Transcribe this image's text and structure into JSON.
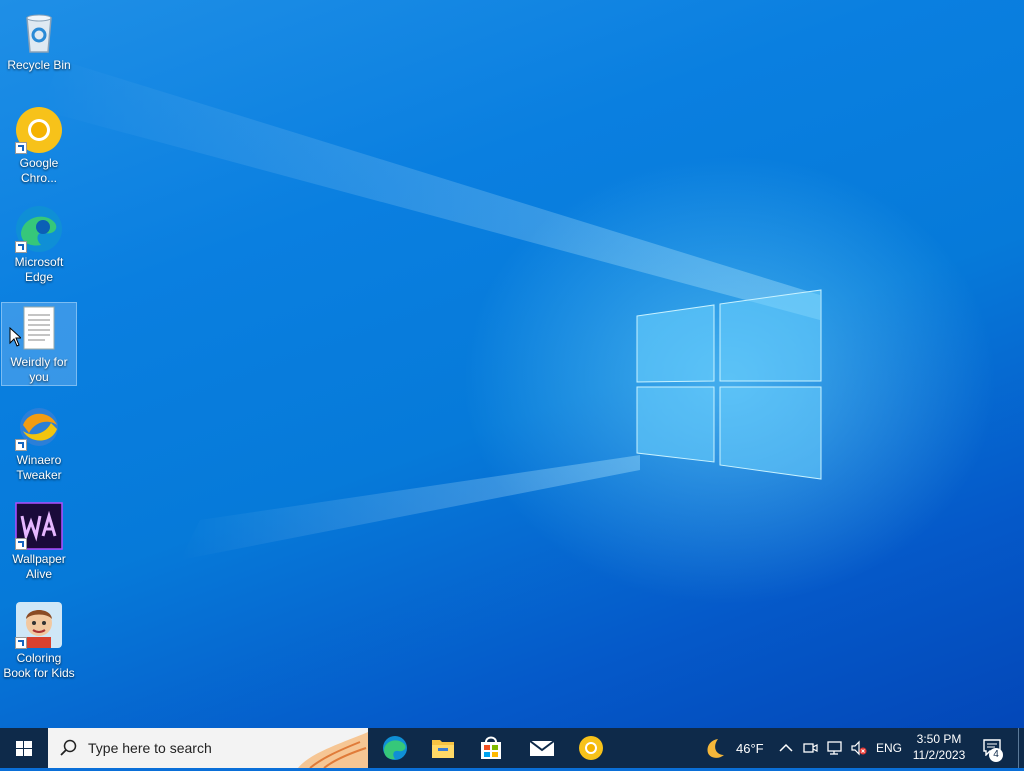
{
  "desktop": {
    "icons": [
      {
        "label": "Recycle Bin"
      },
      {
        "label": "Google Chro..."
      },
      {
        "label": "Microsoft Edge"
      },
      {
        "label": "Weirdly for you"
      },
      {
        "label": "Winaero Tweaker"
      },
      {
        "label": "Wallpaper Alive"
      },
      {
        "label": "Coloring Book for Kids"
      }
    ],
    "wallpaper_colors": {
      "base": "#0a7fe0",
      "glow": "#78dcff",
      "dark": "#0347b8"
    }
  },
  "taskbar": {
    "search_placeholder": "Type here to search",
    "pinned_apps": [
      "edge-icon",
      "file-explorer-icon",
      "store-icon",
      "mail-icon",
      "chrome-icon"
    ],
    "weather": {
      "temperature": "46°F",
      "icon": "moon-icon"
    },
    "language": "ENG",
    "clock": {
      "time": "3:50 PM",
      "date": "11/2/2023"
    },
    "notification_count": "4",
    "background": "#0e2a4a"
  }
}
